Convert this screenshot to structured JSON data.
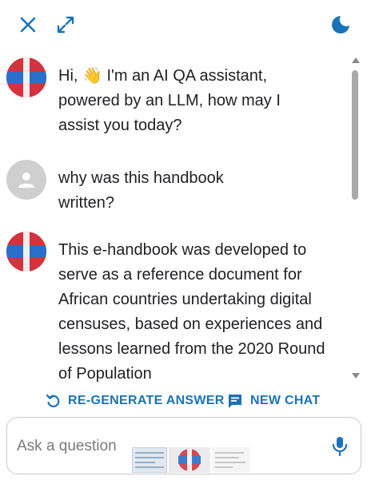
{
  "header": {
    "close_icon": "close-icon",
    "expand_icon": "expand-icon",
    "theme_icon": "moon-icon"
  },
  "colors": {
    "accent": "#1a73b8",
    "avatar_red": "#d4323c",
    "avatar_blue": "#2a6fc9",
    "user_avatar_bg": "#cfcfcf"
  },
  "messages": [
    {
      "role": "assistant",
      "avatar_icon": "assistant-avatar-icon",
      "text": "Hi, 👋 I'm an AI QA assistant, powered by an LLM, how may I assist you today?"
    },
    {
      "role": "user",
      "avatar_icon": "user-avatar-icon",
      "text": "why was this handbook written?"
    },
    {
      "role": "assistant",
      "avatar_icon": "assistant-avatar-icon",
      "text": "This e-handbook was developed to serve as a reference document for African countries undertaking digital censuses, based on experiences and lessons learned from the 2020 Round of Population"
    }
  ],
  "actions": {
    "regenerate_label": "RE-GENERATE ANSWER",
    "new_chat_label": "NEW CHAT"
  },
  "input": {
    "placeholder": "Ask a question",
    "mic_icon": "microphone-icon"
  }
}
